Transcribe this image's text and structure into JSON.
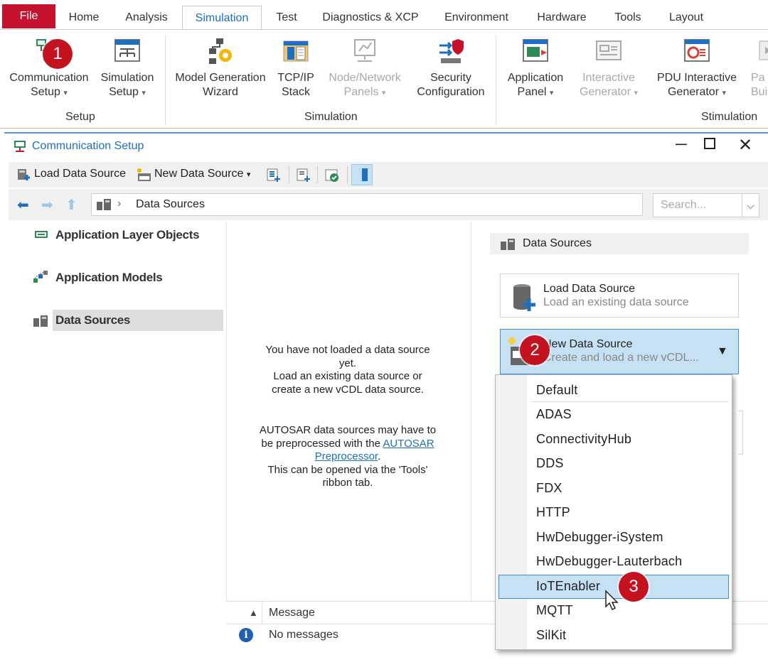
{
  "tabs": [
    "File",
    "Home",
    "Analysis",
    "Simulation",
    "Test",
    "Diagnostics & XCP",
    "Environment",
    "Hardware",
    "Tools",
    "Layout"
  ],
  "ribbon": {
    "comm_setup": [
      "Communication",
      "Setup"
    ],
    "sim_setup": [
      "Simulation",
      "Setup"
    ],
    "model_gen": [
      "Model Generation",
      "Wizard"
    ],
    "tcpip": [
      "TCP/IP",
      "Stack"
    ],
    "node_panels": [
      "Node/Network",
      "Panels"
    ],
    "security": [
      "Security",
      "Configuration"
    ],
    "app_panel": [
      "Application",
      "Panel"
    ],
    "interactive_gen": [
      "Interactive",
      "Generator"
    ],
    "pdu_gen": [
      "PDU Interactive",
      "Generator"
    ],
    "partial": [
      "Pa",
      "Buil"
    ],
    "groups": {
      "setup": "Setup",
      "simulation": "Simulation",
      "stimulation": "Stimulation"
    },
    "dropdown_glyph": "▾"
  },
  "window": {
    "title": "Communication Setup"
  },
  "toolbar": {
    "load": "Load Data Source",
    "new": "New Data Source"
  },
  "nav": {
    "breadcrumb": "Data Sources",
    "search_placeholder": "Search..."
  },
  "left": {
    "items": [
      "Application Layer Objects",
      "Application Models",
      "Data Sources"
    ]
  },
  "middle": {
    "line1": "You have not loaded a data source",
    "line2": "yet.",
    "line3": "Load an existing data source or",
    "line4": "create a new vCDL data source.",
    "line5": "AUTOSAR data sources may have to",
    "line6a": "be preprocessed with the ",
    "line6link": "AUTOSAR",
    "line7link": "Preprocessor",
    "line7b": ".",
    "line8": "This can be opened via the 'Tools'",
    "line9": "ribbon tab."
  },
  "right": {
    "header": "Data Sources",
    "load_title": "Load Data Source",
    "load_sub": "Load an existing data source",
    "new_title": "New Data Source",
    "new_sub": "Create and load a new vCDL..."
  },
  "dropdown": {
    "items": [
      "Default",
      "ADAS",
      "ConnectivityHub",
      "DDS",
      "FDX",
      "HTTP",
      "HwDebugger-iSystem",
      "HwDebugger-Lauterbach",
      "IoTEnabler",
      "MQTT",
      "SilKit"
    ],
    "highlighted": "IoTEnabler"
  },
  "messages": {
    "header": "Message",
    "text": "No messages"
  },
  "badges": [
    "1",
    "2",
    "3"
  ],
  "colors": {
    "accent": "#1e6fc0",
    "file_tab": "#c4122f",
    "selection": "#c7e1f4",
    "badge": "#c4121f"
  }
}
